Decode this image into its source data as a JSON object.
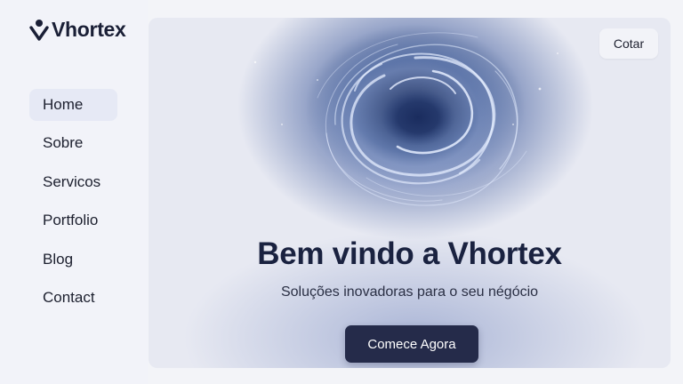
{
  "brand": {
    "name": "Vhortex",
    "icon": "v-pin-logo-icon"
  },
  "sidebar": {
    "items": [
      {
        "label": "Home",
        "active": true
      },
      {
        "label": "Sobre",
        "active": false
      },
      {
        "label": "Servicos",
        "active": false
      },
      {
        "label": "Portfolio",
        "active": false
      },
      {
        "label": "Blog",
        "active": false
      },
      {
        "label": "Contact",
        "active": false
      }
    ]
  },
  "hero": {
    "quote_label": "Cotar",
    "title": "Bem vindo a Vhortex",
    "subtitle": "Soluções inovadoras para o seu négócio",
    "cta_label": "Comece Agora",
    "background": "swirling-vortex-image"
  },
  "colors": {
    "accent": "#252b4a",
    "text": "#1a2240",
    "sidebar_bg": "#f2f3f9",
    "active_item_bg": "#e6e9f5"
  }
}
